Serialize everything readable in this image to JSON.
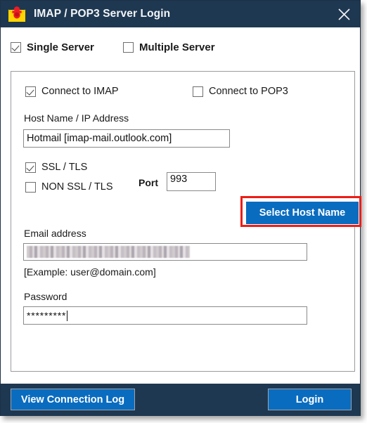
{
  "window": {
    "title": "IMAP / POP3 Server Login",
    "app_icon": "envelope-heart-icon",
    "close_icon": "close-icon",
    "titlebar_color": "#1f3851",
    "accent_color": "#0a6cbf",
    "highlight_color": "#ee1c16"
  },
  "server_mode": {
    "single": {
      "label": "Single Server",
      "checked": true
    },
    "multiple": {
      "label": "Multiple Server",
      "checked": false
    }
  },
  "protocol": {
    "imap": {
      "label": "Connect to IMAP",
      "checked": true
    },
    "pop3": {
      "label": "Connect to POP3",
      "checked": false
    }
  },
  "host": {
    "label": "Host Name / IP Address",
    "value": "Hotmail [imap-mail.outlook.com]",
    "placeholder": "",
    "select_button": "Select Host Name"
  },
  "security": {
    "ssl": {
      "label": "SSL / TLS",
      "checked": true
    },
    "non_ssl": {
      "label": "NON SSL / TLS",
      "checked": false
    },
    "port_label": "Port",
    "port_value": "993"
  },
  "email": {
    "label": "Email address",
    "value": "",
    "redacted": true,
    "hint": "[Example: user@domain.com]"
  },
  "password": {
    "label": "Password",
    "value": "*********"
  },
  "footer": {
    "view_log": "View Connection Log",
    "login": "Login"
  }
}
